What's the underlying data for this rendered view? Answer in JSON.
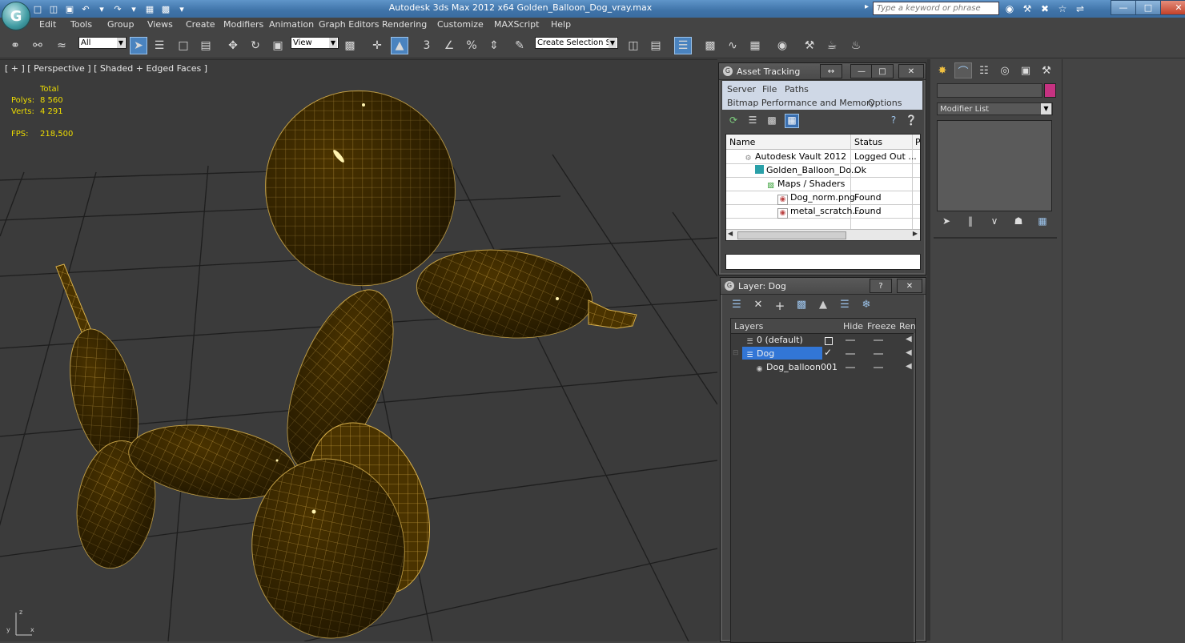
{
  "window": {
    "title": "Autodesk 3ds Max  2012 x64      Golden_Balloon_Dog_vray.max",
    "search_placeholder": "Type a keyword or phrase",
    "logo_letter": "G"
  },
  "menu": [
    "Edit",
    "Tools",
    "Group",
    "Views",
    "Create",
    "Modifiers",
    "Animation",
    "Graph Editors",
    "Rendering",
    "Customize",
    "MAXScript",
    "Help"
  ],
  "toolbar": {
    "selection_filter": "All",
    "ref_coord": "View",
    "named_selection_placeholder": "Create Selection Se",
    "snap_labels": [
      "3",
      "%"
    ]
  },
  "viewport": {
    "label": "[ + ] [ Perspective ] [ Shaded + Edged Faces ]",
    "stats_header": "Total",
    "polys_label": "Polys:",
    "polys_value": "8 560",
    "verts_label": "Verts:",
    "verts_value": "4 291",
    "fps_label": "FPS:",
    "fps_value": "218,500",
    "axis_labels": [
      "x",
      "y",
      "z"
    ]
  },
  "asset_tracking": {
    "title": "Asset Tracking",
    "menu_row1": [
      "Server",
      "File",
      "Paths"
    ],
    "menu_row2": [
      "Bitmap Performance and Memory",
      "Options"
    ],
    "columns": [
      "Name",
      "Status",
      "P"
    ],
    "rows": [
      {
        "name": "Autodesk Vault 2012",
        "status": "Logged Out ...",
        "indent": 0
      },
      {
        "name": "Golden_Balloon_Do...",
        "status": "Ok",
        "indent": 1
      },
      {
        "name": "Maps / Shaders",
        "status": "",
        "indent": 2
      },
      {
        "name": "Dog_norm.png",
        "status": "Found",
        "indent": 3
      },
      {
        "name": "metal_scratch...",
        "status": "Found",
        "indent": 3
      }
    ],
    "path_value": ""
  },
  "layer_dialog": {
    "title": "Layer: Dog",
    "columns": [
      "Layers",
      "Hide",
      "Freeze",
      "Ren"
    ],
    "rows": [
      {
        "name": "0 (default)",
        "indent": 0,
        "selected": false
      },
      {
        "name": "Dog",
        "indent": 0,
        "selected": true
      },
      {
        "name": "Dog_balloon001",
        "indent": 1,
        "selected": false
      }
    ]
  },
  "command_panel": {
    "modifier_list": "Modifier List",
    "object_color": "#c63281"
  },
  "colors": {
    "title_bar": "#3f73a8",
    "ui_background": "#444444",
    "viewport_bg": "#3b3b3b",
    "grid": "#1e1e1e",
    "balloon": "#4a3300",
    "wire": "#d8b04a",
    "stats_text": "#eedd00",
    "selection": "#3276d6"
  }
}
